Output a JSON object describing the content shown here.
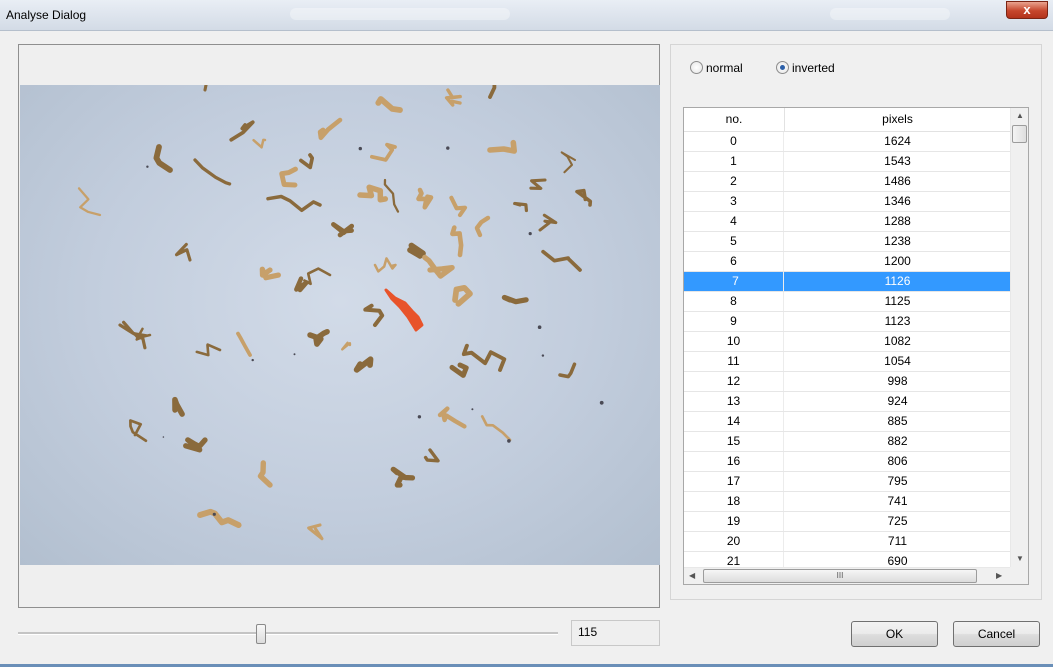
{
  "window": {
    "title": "Analyse Dialog",
    "close_glyph": "x"
  },
  "mode": {
    "options": [
      "normal",
      "inverted"
    ],
    "selected": "inverted"
  },
  "threshold": {
    "value": "115",
    "slider_fraction": 0.45
  },
  "table": {
    "columns": [
      "no.",
      "pixels"
    ],
    "selected_row": 7,
    "rows": [
      [
        "0",
        "1624"
      ],
      [
        "1",
        "1543"
      ],
      [
        "2",
        "1486"
      ],
      [
        "3",
        "1346"
      ],
      [
        "4",
        "1288"
      ],
      [
        "5",
        "1238"
      ],
      [
        "6",
        "1200"
      ],
      [
        "7",
        "1126"
      ],
      [
        "8",
        "1125"
      ],
      [
        "9",
        "1123"
      ],
      [
        "10",
        "1082"
      ],
      [
        "11",
        "1054"
      ],
      [
        "12",
        "998"
      ],
      [
        "13",
        "924"
      ],
      [
        "14",
        "885"
      ],
      [
        "15",
        "882"
      ],
      [
        "16",
        "806"
      ],
      [
        "17",
        "795"
      ],
      [
        "18",
        "741"
      ],
      [
        "19",
        "725"
      ],
      [
        "20",
        "711"
      ],
      [
        "21",
        "690"
      ]
    ],
    "hscroll_grip": "III"
  },
  "buttons": {
    "ok": "OK",
    "cancel": "Cancel"
  },
  "colors": {
    "selection": "#3399ff",
    "highlight_particle": "#e8532a",
    "particle": "#8a6a3c"
  }
}
